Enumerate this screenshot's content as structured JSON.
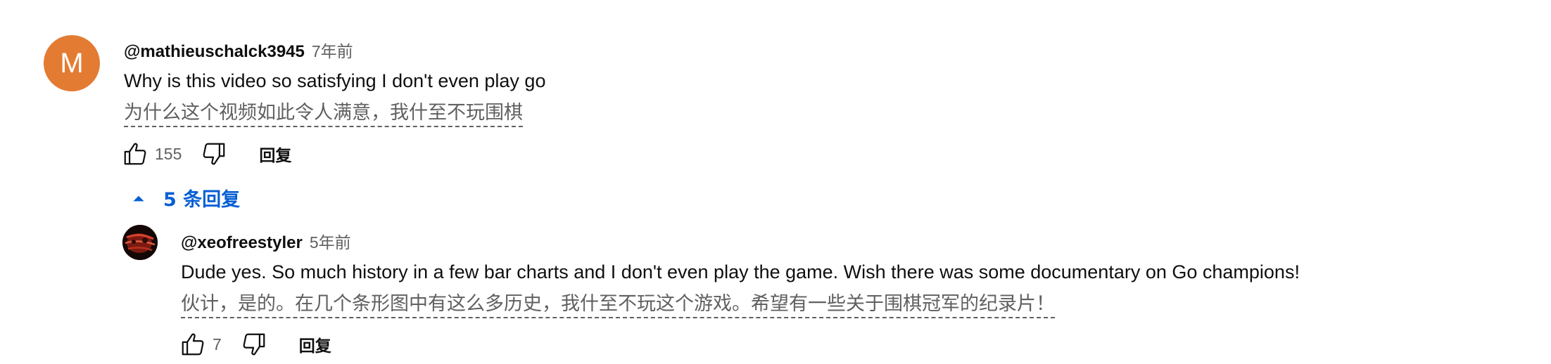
{
  "comment": {
    "avatar_letter": "M",
    "author": "@mathieuschalck3945",
    "time": "7年前",
    "text": "Why is this video so satisfying I don't even play go",
    "translation": "为什么这个视频如此令人满意，我什至不玩围棋",
    "likes": "155",
    "reply_label": "回复"
  },
  "replies_toggle": {
    "label": "5 条回复",
    "icon": "chevron-up-icon"
  },
  "reply": {
    "author": "@xeofreestyler",
    "time": "5年前",
    "text": "Dude yes. So much history in a few bar charts and I don't even play the game. Wish there was some documentary on Go champions!",
    "translation": "伙计，是的。在几个条形图中有这么多历史，我什至不玩这个游戏。希望有一些关于围棋冠军的纪录片！",
    "likes": "7",
    "reply_label": "回复"
  },
  "colors": {
    "avatar_bg": "#e47b33",
    "link_blue": "#065fd4",
    "secondary_text": "#606060"
  }
}
